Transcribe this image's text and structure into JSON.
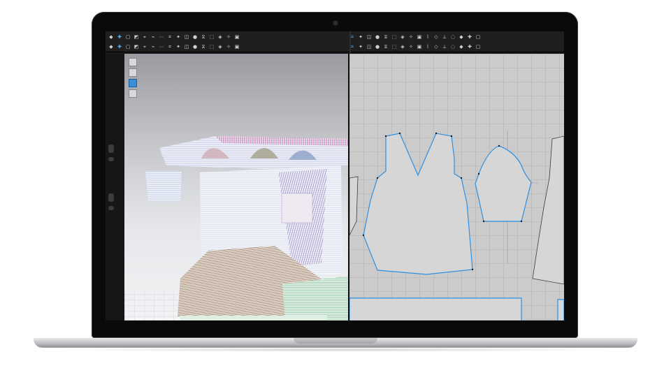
{
  "colors": {
    "laptop_bezel": "#0a0a0a",
    "toolbar_bg": "#1f1f1f",
    "accent": "#4fb3ff",
    "pattern_outline": "#2f8fe0",
    "pattern_fill": "#d6d6d6",
    "grid_bg": "#cbcbcb"
  },
  "toolbar": {
    "row1_icons": [
      "select-icon",
      "move-icon",
      "rect-icon",
      "transform-icon",
      "pin-icon",
      "fold-icon",
      "sew-icon",
      "seam-icon",
      "tack-icon",
      "pleat-icon",
      "button-icon",
      "zip-icon",
      "arrange-icon",
      "sim-icon",
      "avatar-icon",
      "fabric-icon",
      "brush-icon",
      "measure-icon",
      "texture-icon",
      "hide-icon"
    ],
    "row2_icons": [
      "stitch-icon",
      "line-icon",
      "curve-icon",
      "point-icon",
      "cut-icon",
      "notch-icon",
      "dart-icon",
      "grade-icon",
      "offset-icon",
      "mirror-icon",
      "sym-icon",
      "align-icon",
      "match-icon",
      "length-icon",
      "internal-icon",
      "circle-icon",
      "trace-icon",
      "unfold-icon",
      "grain-icon",
      "rotate-icon"
    ],
    "right_row1_icons": [
      "edit-pattern-icon",
      "transform-pattern-icon",
      "edit-curve-icon",
      "add-point-icon",
      "polygon-icon",
      "rectangle-icon",
      "ellipse-icon",
      "internal-polygon-icon",
      "internal-rect-icon",
      "internal-circle-icon",
      "dart-tool-icon",
      "trace-tool-icon",
      "segment-icon",
      "sew-tool-icon",
      "free-sew-icon",
      "check-icon"
    ],
    "right_row2_icons": [
      "seam-allow-icon",
      "binding-icon",
      "pleat-tool-icon",
      "fold-tool-icon",
      "notch-tool-icon",
      "grain-tool-icon",
      "graphic-icon",
      "texture-tool-icon",
      "color-icon",
      "button-tool-icon",
      "zip-tool-icon",
      "puckering-icon",
      "tape-icon",
      "layer-icon",
      "measure-tool-icon",
      "ruler-icon"
    ]
  },
  "left_rail": {
    "icons": [
      "collapse-icon",
      "knob-icon",
      "knob-icon",
      "knob-icon"
    ]
  },
  "viewport_tools": [
    "view-mode-icon",
    "light-icon",
    "texture-mode-icon",
    "avatar-toggle-icon"
  ],
  "pattern_pieces": [
    "front-bodice",
    "sleeve",
    "back-bodice",
    "waist-band"
  ]
}
